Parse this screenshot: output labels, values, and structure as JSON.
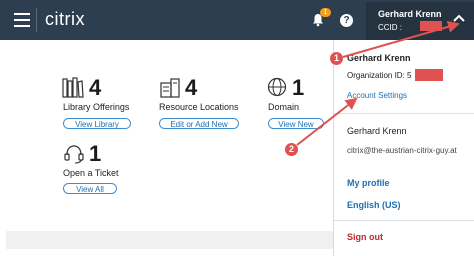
{
  "header": {
    "logo_text": "citrix",
    "notification_count": "1",
    "help_symbol": "?",
    "user_name": "Gerhard Krenn",
    "ccid_label": "CCID : "
  },
  "tiles": [
    {
      "count": "4",
      "label": "Library Offerings",
      "button": "View Library",
      "icon": "library-icon"
    },
    {
      "count": "4",
      "label": "Resource Locations",
      "button": "Edit or Add New",
      "icon": "resource-location-icon"
    },
    {
      "count": "1",
      "label": "Domain",
      "button": "View New",
      "icon": "globe-icon"
    },
    {
      "count": "1",
      "label": "Open a Ticket",
      "button": "View All",
      "icon": "headset-icon"
    }
  ],
  "dropdown": {
    "customer_name": "Gerhard Krenn",
    "org_label": "Organization ID: 5",
    "account_settings": "Account Settings",
    "user_name": "Gerhard Krenn",
    "email": "citrix@the-austrian-citrix-guy.at",
    "my_profile": "My profile",
    "language": "English (US)",
    "sign_out": "Sign out"
  },
  "annotations": {
    "marker1": "1",
    "marker2": "2"
  },
  "colors": {
    "topbar": "#2c3e4f",
    "accent": "#1f6fb2",
    "marker": "#e05252",
    "signout": "#c0262d"
  }
}
